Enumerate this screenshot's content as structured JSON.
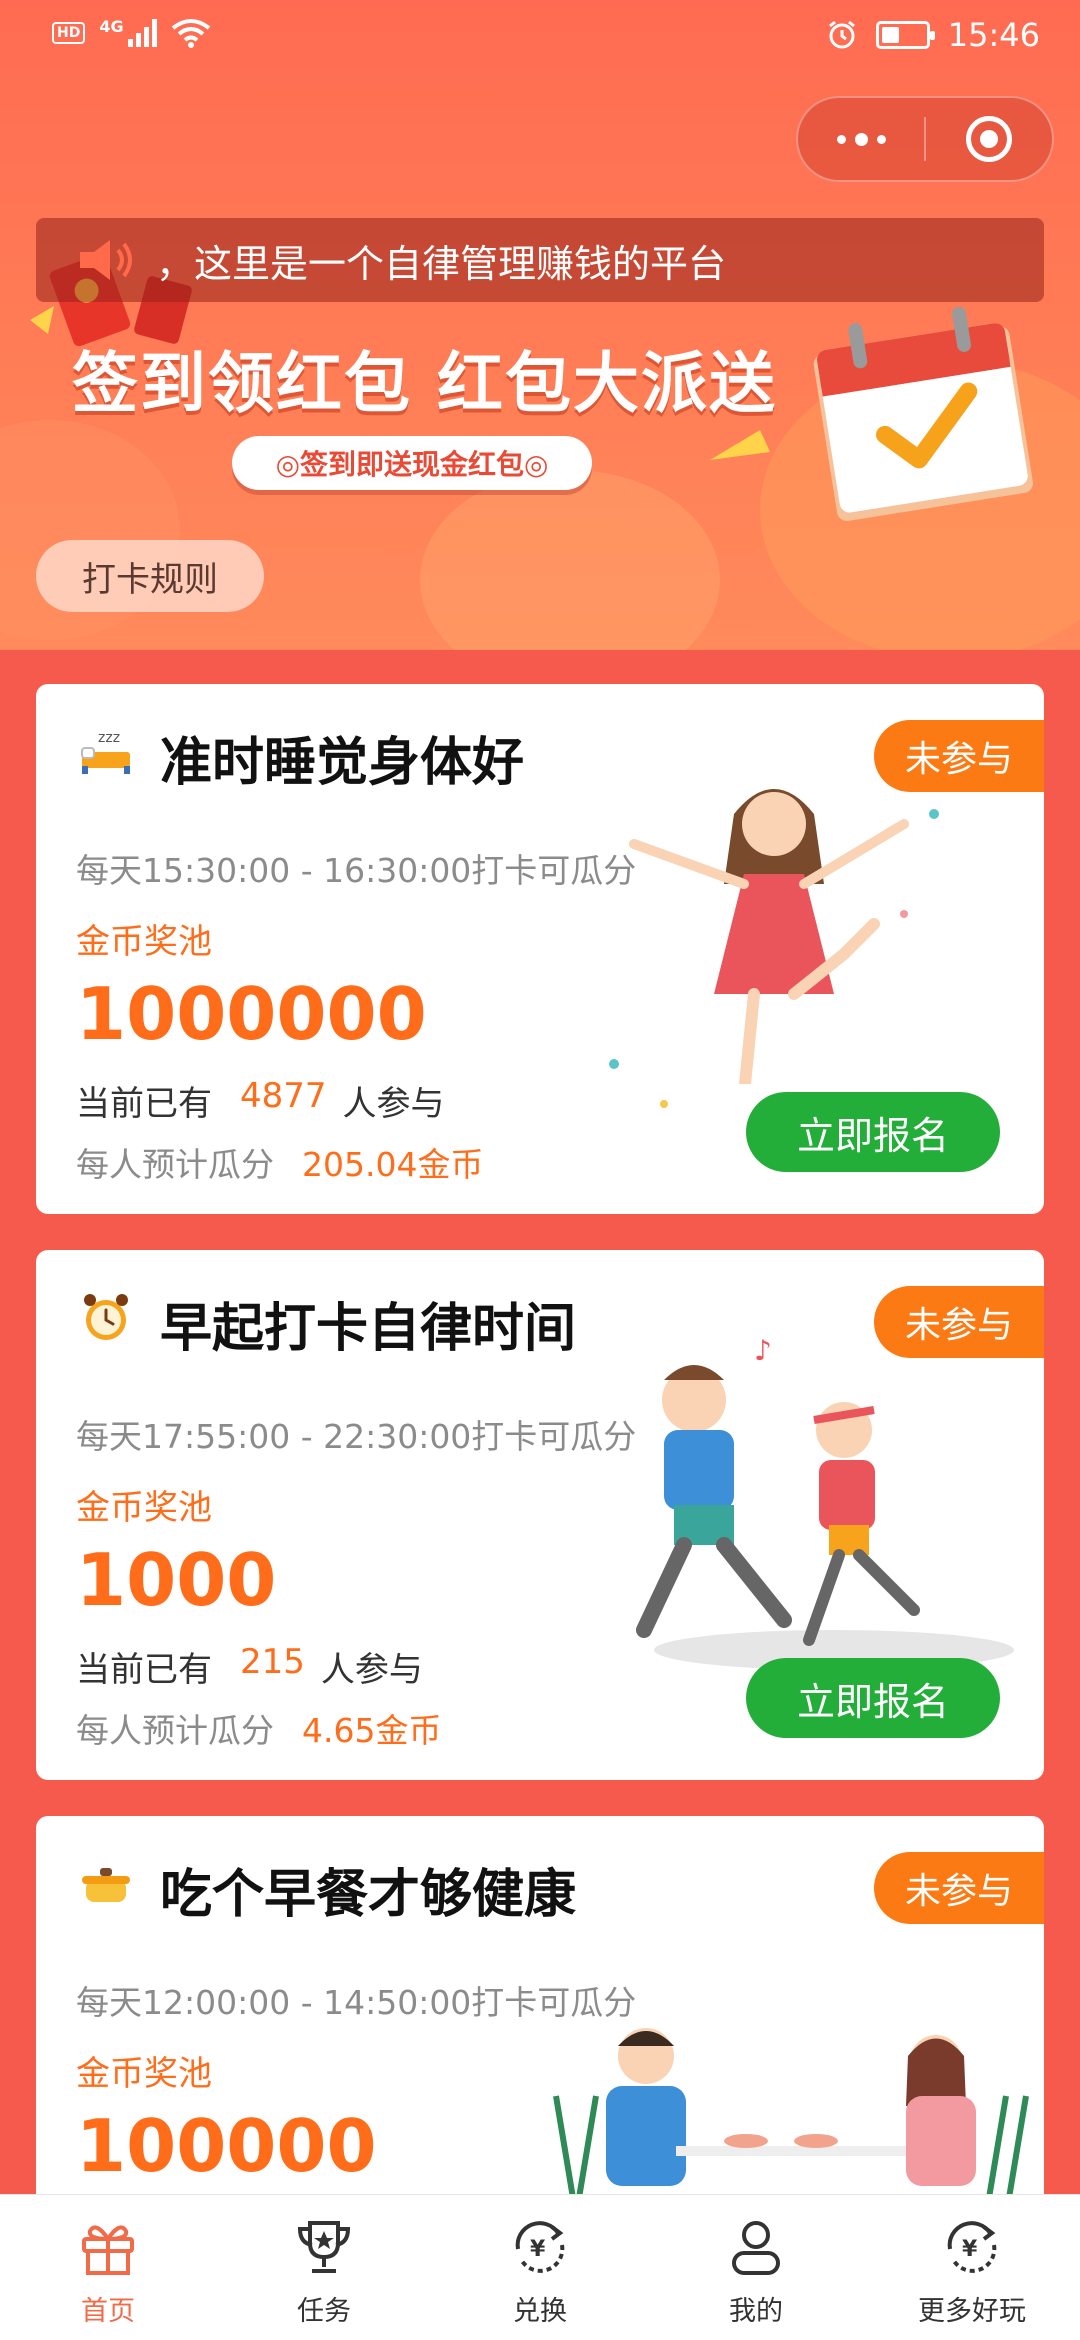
{
  "status_bar": {
    "network_badge": "HD",
    "network_type": "4G",
    "time": "15:46",
    "battery_level": 0.35,
    "icons": [
      "hd-icon",
      "signal-icon",
      "wifi-icon",
      "alarm-icon",
      "battery-icon"
    ]
  },
  "banner": {
    "notice_text": "，这里是一个自律管理赚钱的平台",
    "headline": "签到领红包  红包大派送",
    "subtitle": "◎签到即送现金红包◎",
    "rules_button": "打卡规则"
  },
  "cards": [
    {
      "icon": "sleep-bed-icon",
      "title": "准时睡觉身体好",
      "badge": "未参与",
      "time": "每天15:30:00 - 16:30:00打卡可瓜分",
      "pool_label": "金币奖池",
      "pool": "1000000",
      "joined_prefix": "当前已有",
      "joined_count": "4877",
      "joined_suffix": "人参与",
      "share_label": "每人预计瓜分",
      "share_value": "205.04金币",
      "button": "立即报名"
    },
    {
      "icon": "alarm-clock-icon",
      "title": "早起打卡自律时间",
      "badge": "未参与",
      "time": "每天17:55:00 - 22:30:00打卡可瓜分",
      "pool_label": "金币奖池",
      "pool": "1000",
      "joined_prefix": "当前已有",
      "joined_count": "215",
      "joined_suffix": "人参与",
      "share_label": "每人预计瓜分",
      "share_value": "4.65金币",
      "button": "立即报名"
    },
    {
      "icon": "pot-icon",
      "title": "吃个早餐才够健康",
      "badge": "未参与",
      "time": "每天12:00:00 - 14:50:00打卡可瓜分",
      "pool_label": "金币奖池",
      "pool": "100000"
    }
  ],
  "tabbar": [
    {
      "label": "首页",
      "icon": "gift-icon",
      "active": true
    },
    {
      "label": "任务",
      "icon": "trophy-icon",
      "active": false
    },
    {
      "label": "兑换",
      "icon": "exchange-yuan-icon",
      "active": false
    },
    {
      "label": "我的",
      "icon": "user-icon",
      "active": false
    },
    {
      "label": "更多好玩",
      "icon": "more-yuan-icon",
      "active": false
    }
  ],
  "colors": {
    "page_bg": "#f65a4d",
    "accent_orange": "#ff6d1a",
    "badge_orange": "#fc7a13",
    "button_green": "#23ae3a",
    "tab_active": "#f26b48"
  }
}
